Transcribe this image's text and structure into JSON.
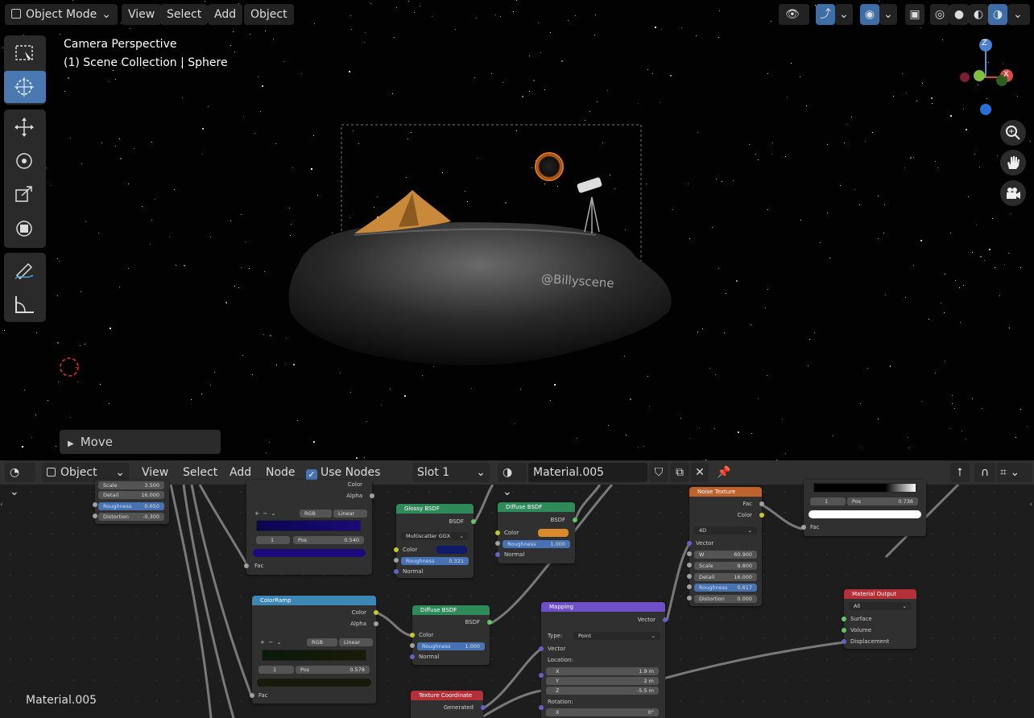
{
  "viewport": {
    "mode": "Object Mode",
    "menu": [
      "View",
      "Select",
      "Add",
      "Object"
    ],
    "overlay_title": "Camera Perspective",
    "overlay_collection": "(1) Scene Collection | Sphere",
    "gizmo_axes": {
      "z": "Z",
      "x": "X"
    },
    "watermark": "@Billyscene",
    "last_operator": "Move"
  },
  "icons": {
    "select_box": "select-box-icon",
    "cursor": "cursor-icon",
    "move": "move-icon",
    "rotate": "rotate-icon",
    "scale": "scale-icon",
    "transform": "transform-icon",
    "annotate": "annotate-icon",
    "measure": "measure-icon",
    "zoom": "zoom-icon",
    "pan": "hand-icon",
    "camera": "camera-icon"
  },
  "node_editor": {
    "editor_type": "Object",
    "menu": [
      "View",
      "Select",
      "Add",
      "Node"
    ],
    "use_nodes_label": "Use Nodes",
    "use_nodes_checked": true,
    "slot": "Slot 1",
    "material": "Material.005",
    "footer_material": "Material.005"
  },
  "nodes": {
    "top_left": {
      "scale": "Scale",
      "scale_val": "3.500",
      "detail": "Detail",
      "detail_val": "16.000",
      "roughness": "Roughness",
      "roughness_val": "0.650",
      "distortion": "Distortion",
      "distortion_val": "-0.300"
    },
    "ramp_top": {
      "color": "Color",
      "alpha": "Alpha",
      "mode": "RGB",
      "interp": "Linear",
      "index": "1",
      "pos": "Pos",
      "pos_val": "0.540",
      "fac": "Fac",
      "stop_color": "#1a0a7a"
    },
    "glossy": {
      "title": "Glossy BSDF",
      "out": "BSDF",
      "dist": "Multiscatter GGX",
      "color": "Color",
      "roughness": "Roughness",
      "roughness_val": "0.321",
      "normal": "Normal",
      "swatch": "#0f1a6a"
    },
    "diffuse_top": {
      "title": "Diffuse BSDF",
      "out": "BSDF",
      "color": "Color",
      "roughness": "Roughness",
      "roughness_val": "1.000",
      "normal": "Normal",
      "swatch": "#d98a2a"
    },
    "noise": {
      "title": "Noise Texture",
      "fac": "Fac",
      "color": "Color",
      "dim": "4D",
      "vector": "Vector",
      "w": "W",
      "w_val": "60.900",
      "scale": "Scale",
      "scale_val": "9.800",
      "detail": "Detail",
      "detail_val": "16.000",
      "roughness": "Roughness",
      "roughness_val": "0.617",
      "distortion": "Distortion",
      "distortion_val": "0.000"
    },
    "ramp_right": {
      "index": "1",
      "pos": "Pos",
      "pos_val": "0.736",
      "fac": "Fac",
      "stop_color": "#ffffff"
    },
    "colorramp": {
      "title": "ColorRamp",
      "color": "Color",
      "alpha": "Alpha",
      "mode": "RGB",
      "interp": "Linear",
      "index": "1",
      "pos": "Pos",
      "pos_val": "0.578",
      "fac": "Fac",
      "stop_color": "#1a1a0a"
    },
    "diffuse_mid": {
      "title": "Diffuse BSDF",
      "out": "BSDF",
      "color": "Color",
      "roughness": "Roughness",
      "roughness_val": "1.000",
      "normal": "Normal"
    },
    "mapping": {
      "title": "Mapping",
      "out": "Vector",
      "type_label": "Type:",
      "type_val": "Point",
      "vector": "Vector",
      "location": "Location:",
      "x": "X",
      "x_val": "1.9 m",
      "y": "Y",
      "y_val": "2 m",
      "z": "Z",
      "z_val": "-5.5 m",
      "rotation": "Rotation:",
      "rx": "X",
      "rx_val": "0°"
    },
    "texcoord": {
      "title": "Texture Coordinate",
      "generated": "Generated"
    },
    "output": {
      "title": "Material Output",
      "target": "All",
      "surface": "Surface",
      "volume": "Volume",
      "displacement": "Displacement"
    }
  },
  "colors": {
    "accent": "#4772b3",
    "header_shader": "#2f8a5a",
    "header_texture": "#c0622b",
    "header_converter": "#3d87b5",
    "header_vector": "#6f4fc7",
    "header_input": "#b5313a",
    "header_output": "#b5313a"
  }
}
